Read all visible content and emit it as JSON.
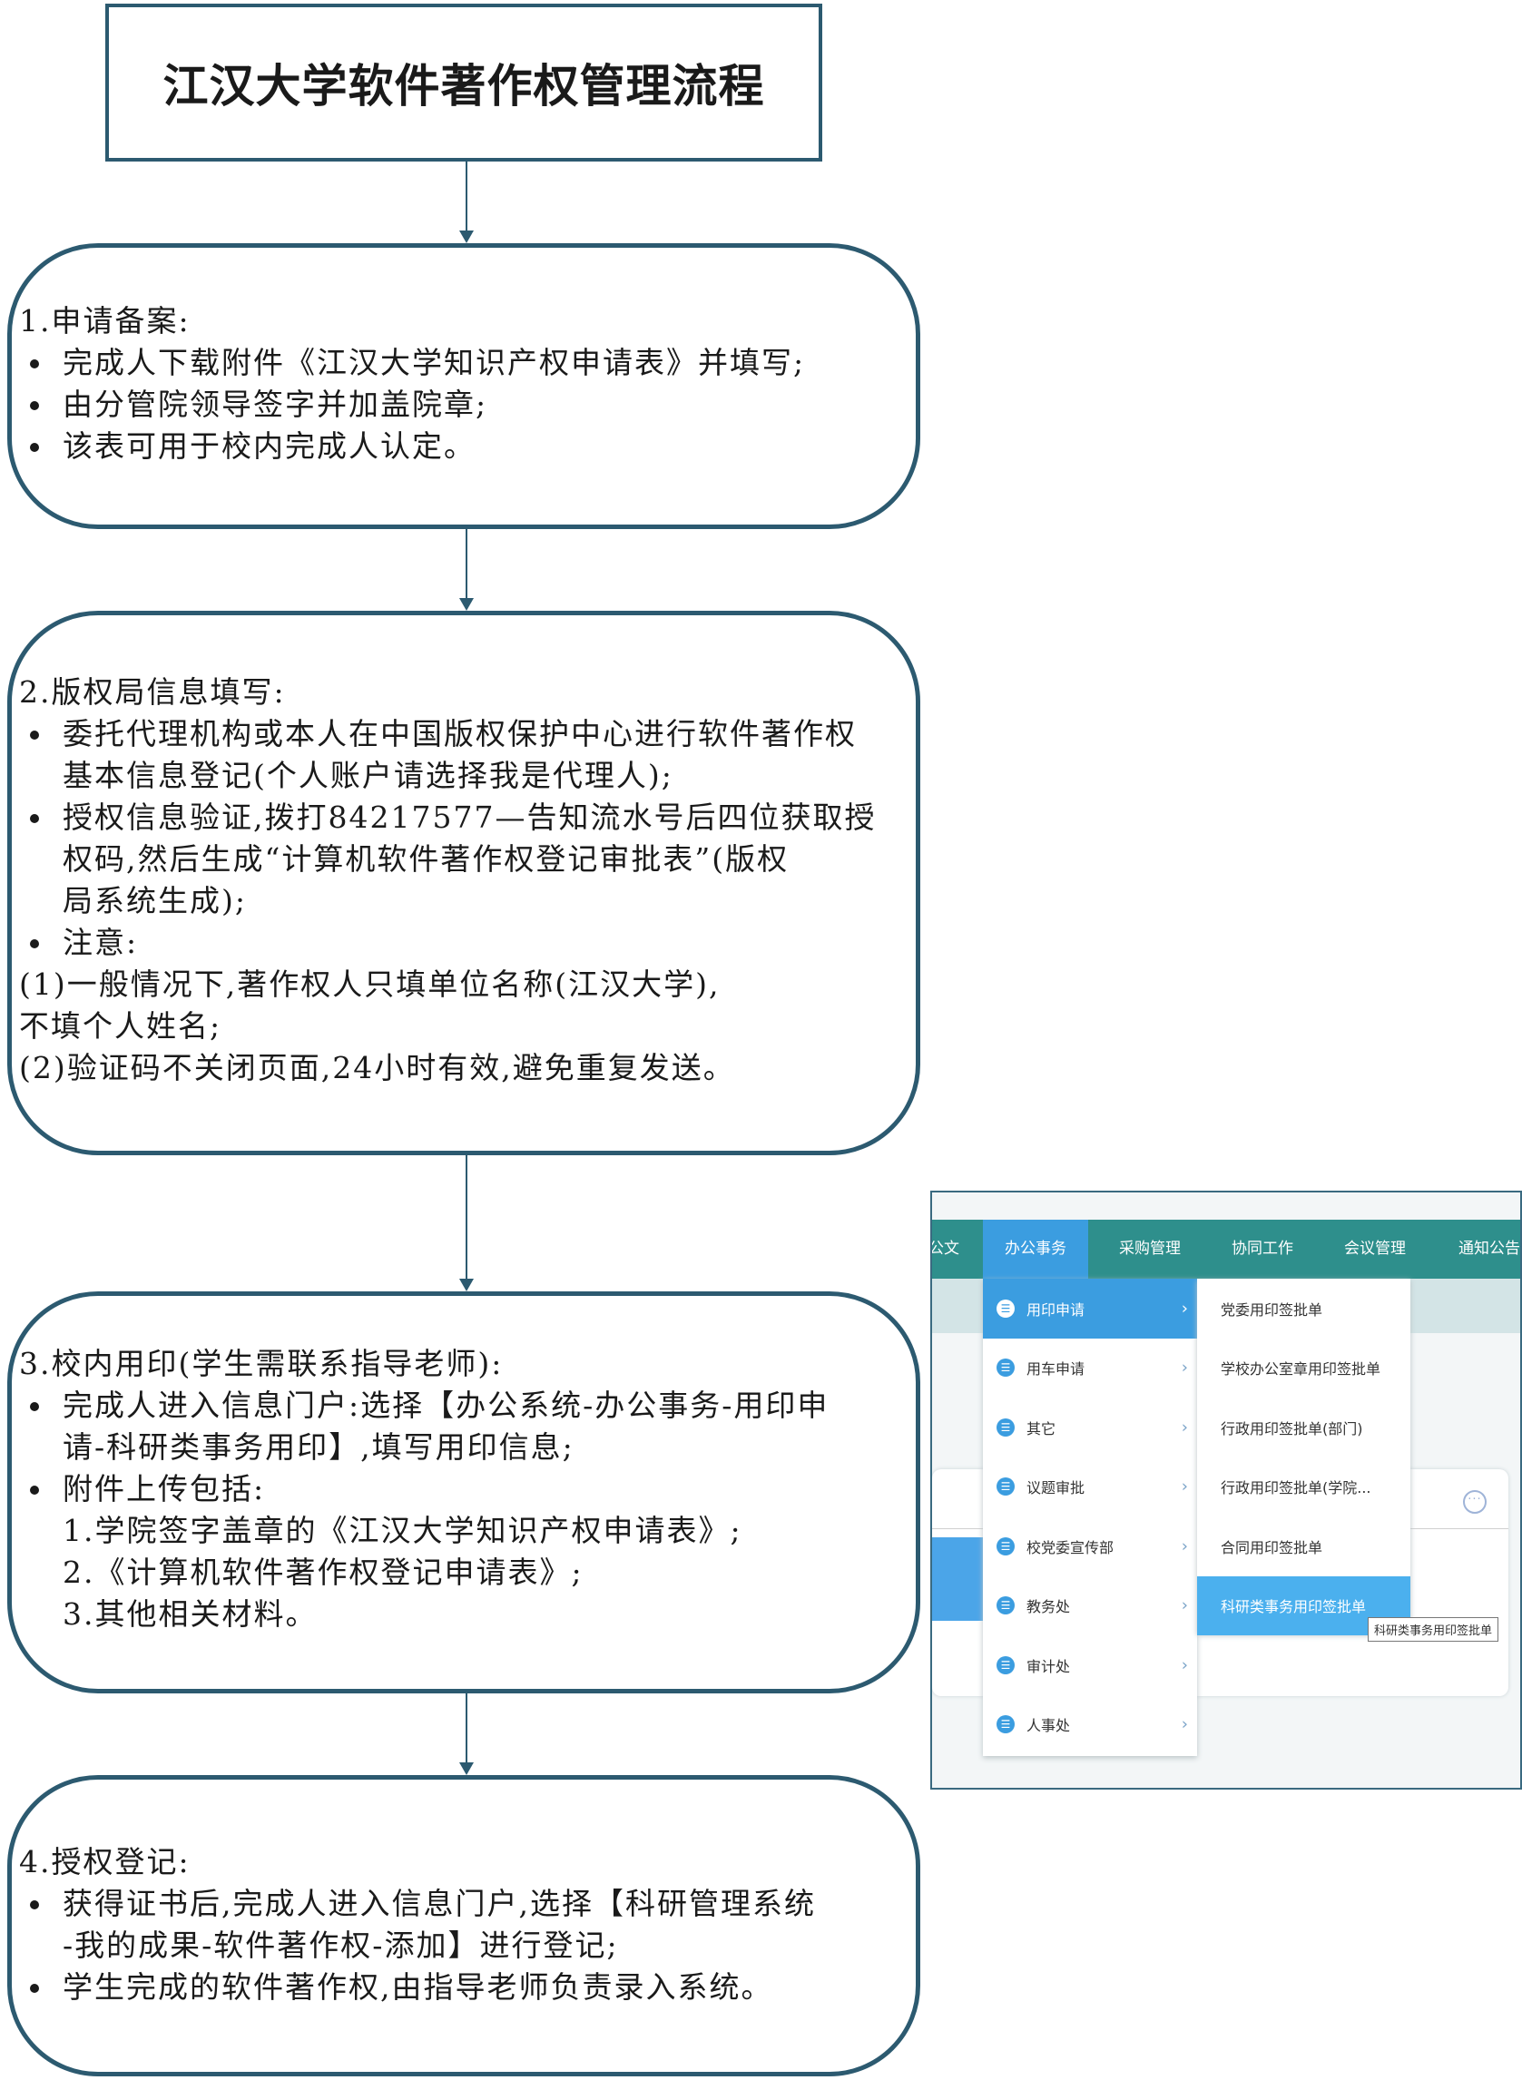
{
  "title": "江汉大学软件著作权管理流程",
  "steps": [
    {
      "title": "1.申请备案:",
      "bullets": [
        "完成人下载附件《江汉大学知识产权申请表》并填写;",
        "由分管院领导签字并加盖院章;",
        "该表可用于校内完成人认定。"
      ]
    },
    {
      "title": "2.版权局信息填写:",
      "bullet1_line1": "委托代理机构或本人在中国版权保护中心进行软件著作权",
      "bullet1_line2": "基本信息登记(个人账户请选择我是代理人);",
      "bullet2_line1": "授权信息验证,拨打84217577—告知流水号后四位获取授",
      "bullet2_line2": "权码,然后生成“计算机软件著作权登记审批表”(版权",
      "bullet2_line3": "局系统生成);",
      "bullet3": "注意:",
      "note1_line1": "(1)一般情况下,著作权人只填单位名称(江汉大学),",
      "note1_line2": "不填个人姓名;",
      "note2": "(2)验证码不关闭页面,24小时有效,避免重复发送。"
    },
    {
      "title": "3.校内用印(学生需联系指导老师):",
      "bullet1_line1": "完成人进入信息门户:选择【办公系统-办公事务-用印申",
      "bullet1_line2": "请-科研类事务用印】,填写用印信息;",
      "bullet2": "附件上传包括:",
      "sub": [
        "1.学院签字盖章的《江汉大学知识产权申请表》;",
        "2.《计算机软件著作权登记申请表》;",
        "3.其他相关材料。"
      ]
    },
    {
      "title": "4.授权登记:",
      "bullet1_line1": "获得证书后,完成人进入信息门户,选择【科研管理系统",
      "bullet1_line2": "-我的成果-软件著作权-添加】进行登记;",
      "bullet2": "学生完成的软件著作权,由指导老师负责录入系统。"
    }
  ],
  "screenshot": {
    "nav": [
      "公文",
      "办公事务",
      "采购管理",
      "协同工作",
      "会议管理",
      "通知公告"
    ],
    "menu1": [
      "用印申请",
      "用车申请",
      "其它",
      "议题审批",
      "校党委宣传部",
      "教务处",
      "审计处",
      "人事处"
    ],
    "menu2": [
      "党委用印签批单",
      "学校办公室章用印签批单",
      "行政用印签批单(部门)",
      "行政用印签批单(学院...",
      "合同用印签批单",
      "科研类事务用印签批单"
    ],
    "tooltip": "科研类事务用印签批单",
    "more_icon": "more-icon"
  },
  "colors": {
    "border": "#2c5a70",
    "nav_bg": "#2e8f8c",
    "accent": "#3b9de0"
  }
}
